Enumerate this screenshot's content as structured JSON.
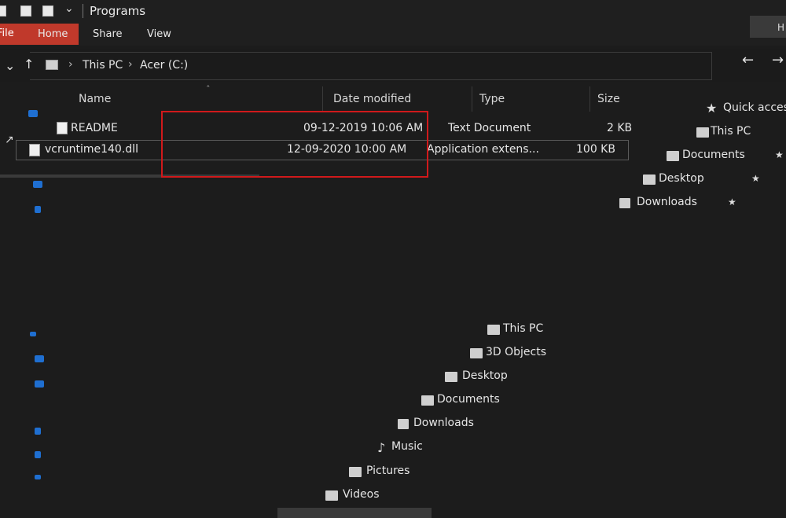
{
  "window": {
    "title": "Programs"
  },
  "quick_access_toolbar": {
    "dropdown_caret": "⌄"
  },
  "ribbon": {
    "tabs": [
      {
        "label": "File"
      },
      {
        "label": "Home"
      },
      {
        "label": "Share"
      },
      {
        "label": "View"
      }
    ],
    "right_tab_label": "H"
  },
  "address": {
    "breadcrumbs": [
      "This PC",
      "Acer (C:)"
    ],
    "sep": "›"
  },
  "columns": [
    {
      "label": "Name"
    },
    {
      "label": "Date modified"
    },
    {
      "label": "Type"
    },
    {
      "label": "Size"
    }
  ],
  "files": [
    {
      "name": "README",
      "date": "09-12-2019 10:06 AM",
      "type": "Text Document",
      "size": "2 KB",
      "icon": "text-file-icon"
    },
    {
      "name": "vcruntime140.dll",
      "date": "12-09-2020 10:00 AM",
      "type": "Application extens...",
      "size": "100 KB",
      "icon": "dll-file-icon"
    }
  ],
  "nav_quick_access": [
    {
      "label": "Quick access",
      "icon": "star-icon"
    },
    {
      "label": "This PC",
      "icon": "computer-icon"
    },
    {
      "label": "Documents",
      "icon": "documents-icon"
    },
    {
      "label": "Desktop",
      "icon": "desktop-icon"
    },
    {
      "label": "Downloads",
      "icon": "downloads-icon"
    }
  ],
  "nav_this_pc": [
    {
      "label": "This PC",
      "icon": "computer-icon"
    },
    {
      "label": "3D Objects",
      "icon": "3d-objects-icon"
    },
    {
      "label": "Desktop",
      "icon": "desktop-icon"
    },
    {
      "label": "Documents",
      "icon": "documents-icon"
    },
    {
      "label": "Downloads",
      "icon": "downloads-icon"
    },
    {
      "label": "Music",
      "icon": "music-icon"
    },
    {
      "label": "Pictures",
      "icon": "pictures-icon"
    },
    {
      "label": "Videos",
      "icon": "videos-icon"
    }
  ],
  "colors": {
    "background": "#1c1c1c",
    "file_tab": "#c0392b",
    "highlight_box": "#d0191b",
    "accent_blue": "#1f6fd1"
  }
}
